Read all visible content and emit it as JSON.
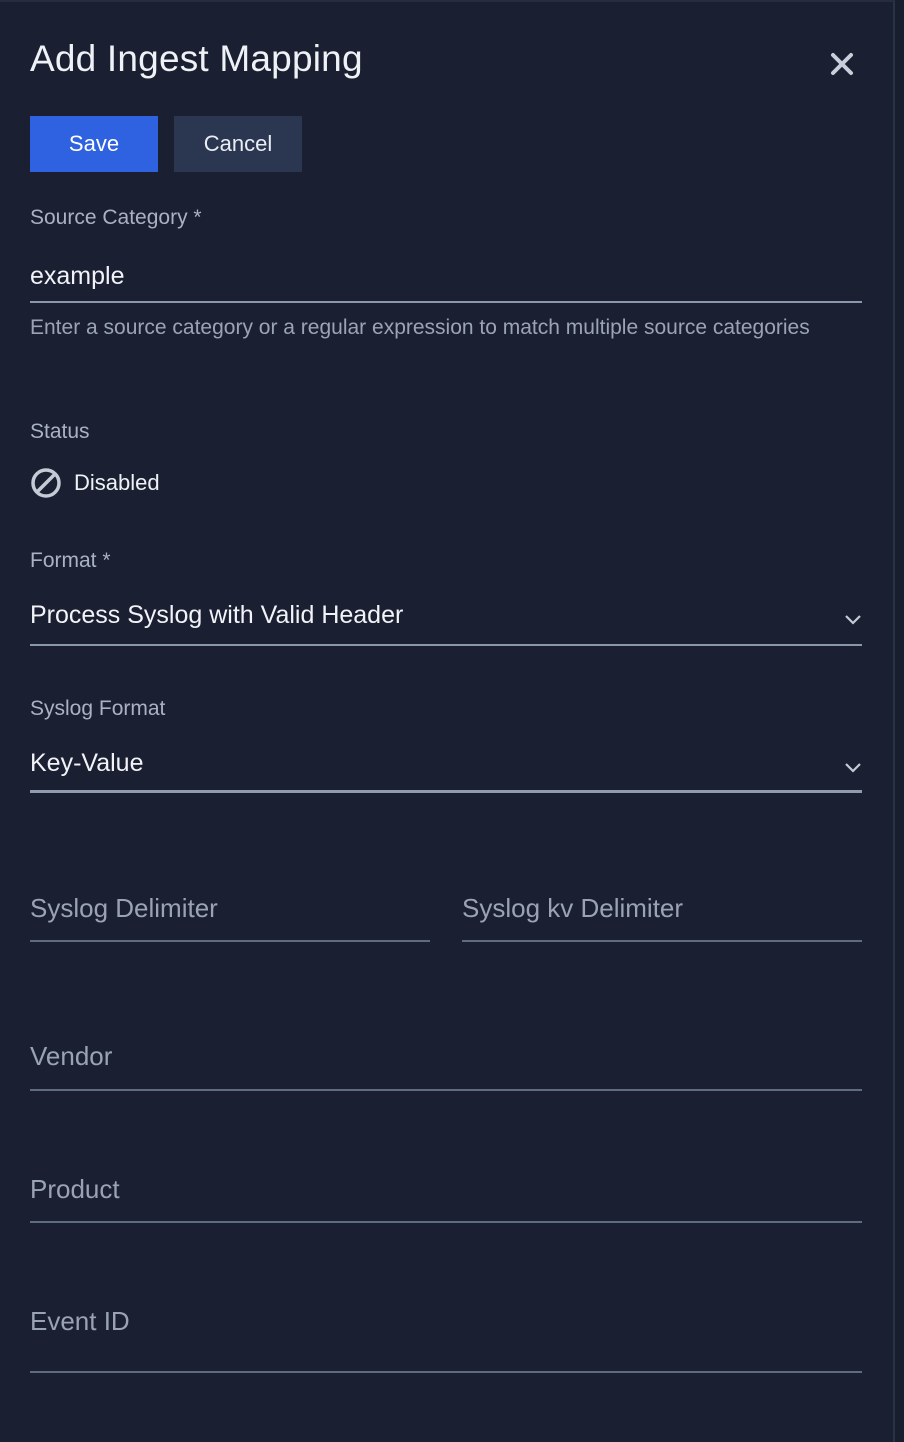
{
  "dialog": {
    "title": "Add Ingest Mapping",
    "close_icon": "close-icon"
  },
  "actions": {
    "save_label": "Save",
    "cancel_label": "Cancel",
    "accent_color": "#2e62e0"
  },
  "source_category": {
    "label": "Source Category *",
    "value": "example",
    "helper": "Enter a source category or a regular expression to match multiple source categories"
  },
  "status": {
    "label": "Status",
    "value": "Disabled",
    "icon": "disabled-icon"
  },
  "format": {
    "label": "Format *",
    "value": "Process Syslog with Valid Header",
    "icon": "chevron-down-icon"
  },
  "syslog_format": {
    "label": "Syslog Format",
    "value": "Key-Value",
    "icon": "chevron-down-icon"
  },
  "syslog_delimiter": {
    "placeholder": "Syslog Delimiter"
  },
  "syslog_kv_delimiter": {
    "placeholder": "Syslog kv Delimiter"
  },
  "vendor": {
    "placeholder": "Vendor"
  },
  "product": {
    "placeholder": "Product"
  },
  "event_id": {
    "placeholder": "Event ID"
  }
}
